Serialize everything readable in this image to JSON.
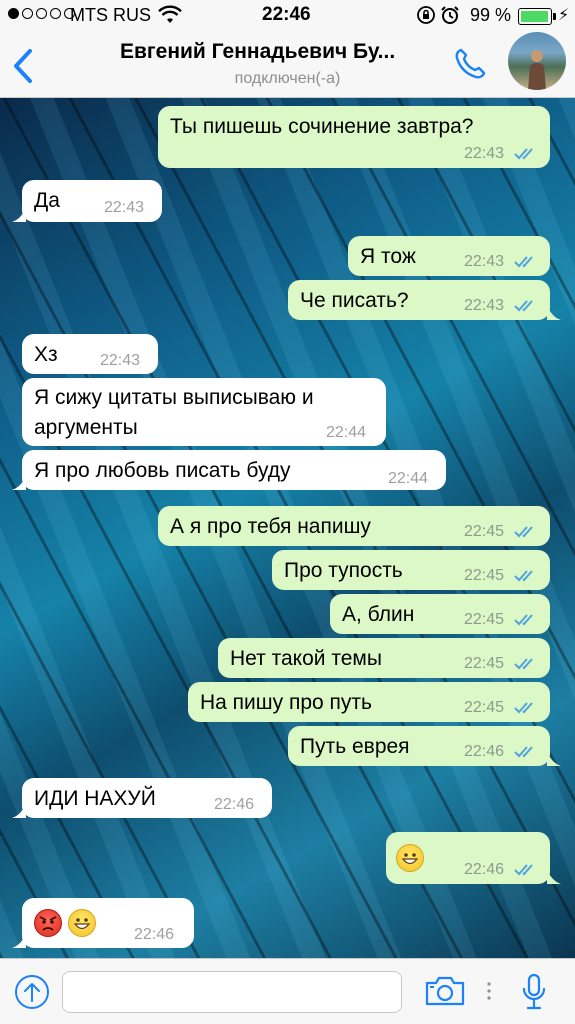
{
  "status": {
    "carrier": "MTS RUS",
    "time": "22:46",
    "battery": "99 %",
    "signal_bars_full": 1,
    "signal_bars_total": 5
  },
  "header": {
    "back_icon": "chevron-left-icon",
    "contact_name": "Евгений Геннадьевич Бу...",
    "contact_status": "подключен(-а)",
    "call_icon": "phone-icon"
  },
  "colors": {
    "outgoing_bubble": "#dcf8c6",
    "incoming_bubble": "#ffffff",
    "read_ticks": "#4fa3e0",
    "accent": "#1a82fb"
  },
  "messages": [
    {
      "dir": "out",
      "text": "Ты пишешь сочинение завтра?",
      "time": "22:43",
      "read": true
    },
    {
      "dir": "in",
      "text": "Да",
      "time": "22:43"
    },
    {
      "dir": "out",
      "text": "Я тож",
      "time": "22:43",
      "read": true
    },
    {
      "dir": "out",
      "text": "Че писать?",
      "time": "22:43",
      "read": true
    },
    {
      "dir": "in",
      "text": "Хз",
      "time": "22:43"
    },
    {
      "dir": "in",
      "text": "Я сижу цитаты выписываю и аргументы",
      "time": "22:44"
    },
    {
      "dir": "in",
      "text": "Я про любовь писать буду",
      "time": "22:44"
    },
    {
      "dir": "out",
      "text": "А я про тебя напишу",
      "time": "22:45",
      "read": true
    },
    {
      "dir": "out",
      "text": "Про тупость",
      "time": "22:45",
      "read": true
    },
    {
      "dir": "out",
      "text": "А, блин",
      "time": "22:45",
      "read": true
    },
    {
      "dir": "out",
      "text": "Нет такой темы",
      "time": "22:45",
      "read": true
    },
    {
      "dir": "out",
      "text": "На пишу про путь",
      "time": "22:45",
      "read": true
    },
    {
      "dir": "out",
      "text": "Путь еврея",
      "time": "22:46",
      "read": true
    },
    {
      "dir": "in",
      "text": "ИДИ НАХУЙ",
      "time": "22:46"
    },
    {
      "dir": "out",
      "emoji": [
        "grinning-face"
      ],
      "time": "22:46",
      "read": true
    },
    {
      "dir": "in",
      "emoji": [
        "angry-face",
        "grinning-face"
      ],
      "time": "22:46"
    }
  ],
  "input": {
    "placeholder": "",
    "value": ""
  }
}
